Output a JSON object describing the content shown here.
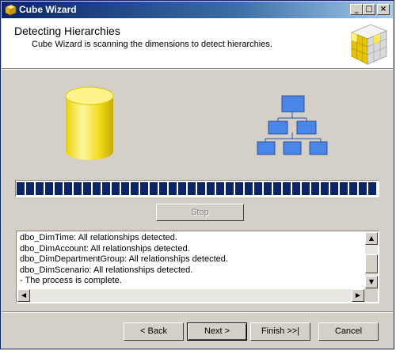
{
  "window": {
    "title": "Cube Wizard",
    "controls": {
      "minimize": "_",
      "maximize": "□",
      "close": "×"
    }
  },
  "header": {
    "title": "Detecting Hierarchies",
    "subtitle": "Cube Wizard is scanning the dimensions to detect hierarchies.",
    "icon": "cube-icon"
  },
  "illustration": {
    "left_icon": "database-cylinder-icon",
    "right_icon": "hierarchy-tree-icon"
  },
  "progress": {
    "value": 1.0
  },
  "stop_button": {
    "label": "Stop",
    "enabled": false
  },
  "log": {
    "lines": [
      "dbo_DimTime: All relationships detected.",
      "dbo_DimAccount: All relationships detected.",
      "dbo_DimDepartmentGroup: All relationships detected.",
      "dbo_DimScenario: All relationships detected.",
      "- The process is complete."
    ]
  },
  "footer": {
    "back_label": "< Back",
    "next_label": "Next >",
    "finish_label": "Finish >>|",
    "cancel_label": "Cancel"
  },
  "colors": {
    "progress_block": "#0a246a",
    "hierarchy_box": "#4a86e8",
    "cylinder": "#f5e34a"
  }
}
